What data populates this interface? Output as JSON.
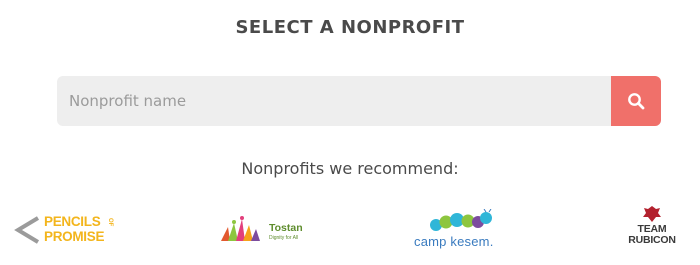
{
  "header": {
    "title": "SELECT A NONPROFIT"
  },
  "search": {
    "placeholder": "Nonprofit name",
    "value": "",
    "button_icon": "search-icon",
    "button_color": "#f0706a"
  },
  "recommendations": {
    "heading": "Nonprofits we recommend:",
    "items": [
      {
        "name": "PENCILS OF PROMISE",
        "logo_lines": [
          "PENCILS",
          "PROMISE"
        ],
        "logo_small": "OF",
        "color": "#f3b51c"
      },
      {
        "name": "Tostan",
        "logo_text": "Tostan",
        "tagline": "Dignity for All",
        "color": "#5f8d2e"
      },
      {
        "name": "camp kesem",
        "logo_text": "camp kesem.",
        "color": "#3a7bbf"
      },
      {
        "name": "TEAM RUBICON",
        "logo_lines": [
          "TEAM",
          "RUBICON"
        ],
        "color": "#b3212e"
      }
    ]
  }
}
